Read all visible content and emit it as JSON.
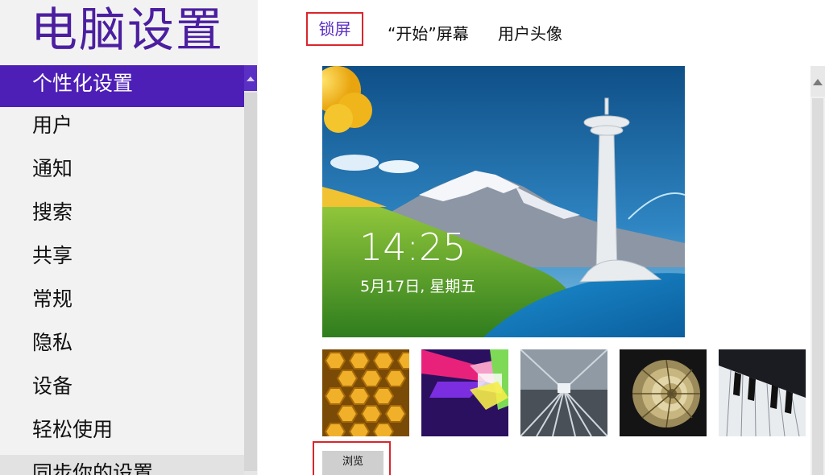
{
  "app": {
    "title": "电脑设置"
  },
  "nav": {
    "items": [
      {
        "label": "个性化设置"
      },
      {
        "label": "用户"
      },
      {
        "label": "通知"
      },
      {
        "label": "搜索"
      },
      {
        "label": "共享"
      },
      {
        "label": "常规"
      },
      {
        "label": "隐私"
      },
      {
        "label": "设备"
      },
      {
        "label": "轻松使用"
      },
      {
        "label": "同步你的设置"
      }
    ],
    "selected": "个性化设置"
  },
  "tabs": [
    {
      "label": "锁屏"
    },
    {
      "label": "“开始”屏幕"
    },
    {
      "label": "用户头像"
    }
  ],
  "preview": {
    "time": "14:25",
    "date": "5月17日, 星期五"
  },
  "thumbnails": [
    {
      "icon": "honeycomb-image"
    },
    {
      "icon": "geometric-image"
    },
    {
      "icon": "train-tracks-image"
    },
    {
      "icon": "nautilus-shell-image"
    },
    {
      "icon": "piano-keys-image"
    }
  ],
  "browse": {
    "label": "浏览"
  },
  "colors": {
    "accent": "#4d1fb6",
    "title": "#4b1ea0",
    "highlight_box": "#d9262c"
  }
}
